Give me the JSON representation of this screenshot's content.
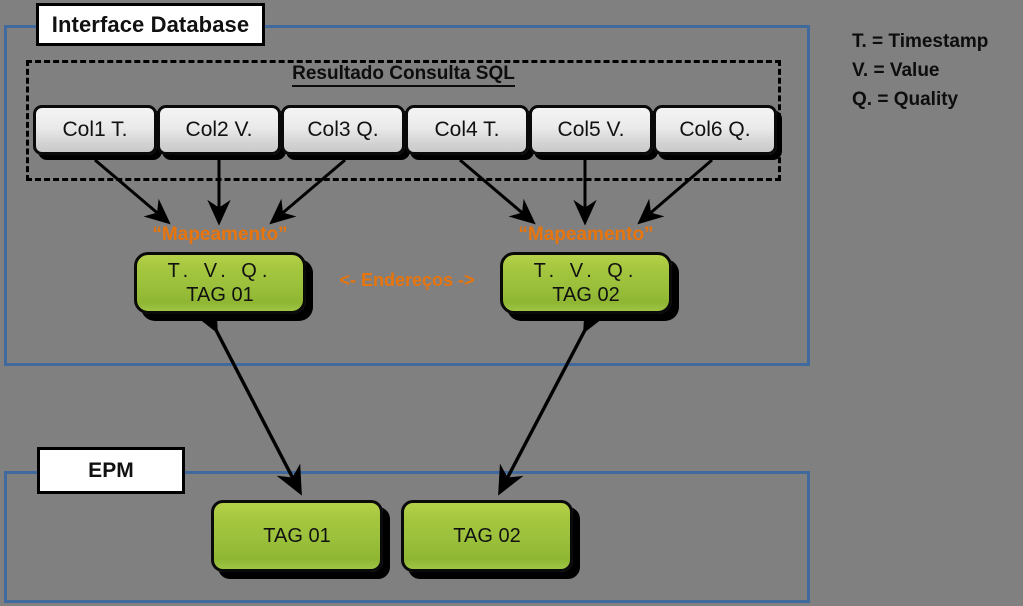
{
  "panels": {
    "interface": {
      "title": "Interface Database"
    },
    "epm": {
      "title": "EPM"
    }
  },
  "sql_group": {
    "caption": "Resultado Consulta SQL"
  },
  "columns": [
    {
      "label": "Col1 T."
    },
    {
      "label": "Col2 V."
    },
    {
      "label": "Col3 Q."
    },
    {
      "label": "Col4 T."
    },
    {
      "label": "Col5 V."
    },
    {
      "label": "Col6 Q."
    }
  ],
  "mapping": {
    "label_left": "“Mapeamento”",
    "label_right": "“Mapeamento”",
    "enderecos": "<- Endereços ->"
  },
  "interface_tags": [
    {
      "fields": "T.  V.  Q.",
      "name": "TAG 01"
    },
    {
      "fields": "T.  V.  Q.",
      "name": "TAG 02"
    }
  ],
  "epm_tags": [
    {
      "name": "TAG 01"
    },
    {
      "name": "TAG 02"
    }
  ],
  "legend": [
    {
      "text": "T. = Timestamp"
    },
    {
      "text": "V. = Value"
    },
    {
      "text": "Q. = Quality"
    }
  ],
  "colors": {
    "background": "#808080",
    "panel_border": "#40699E",
    "green_fill": "#9BC03B",
    "accent_orange": "#E8740C",
    "chip_fill": "#EAEAEA",
    "outline": "#0A0A0A"
  }
}
